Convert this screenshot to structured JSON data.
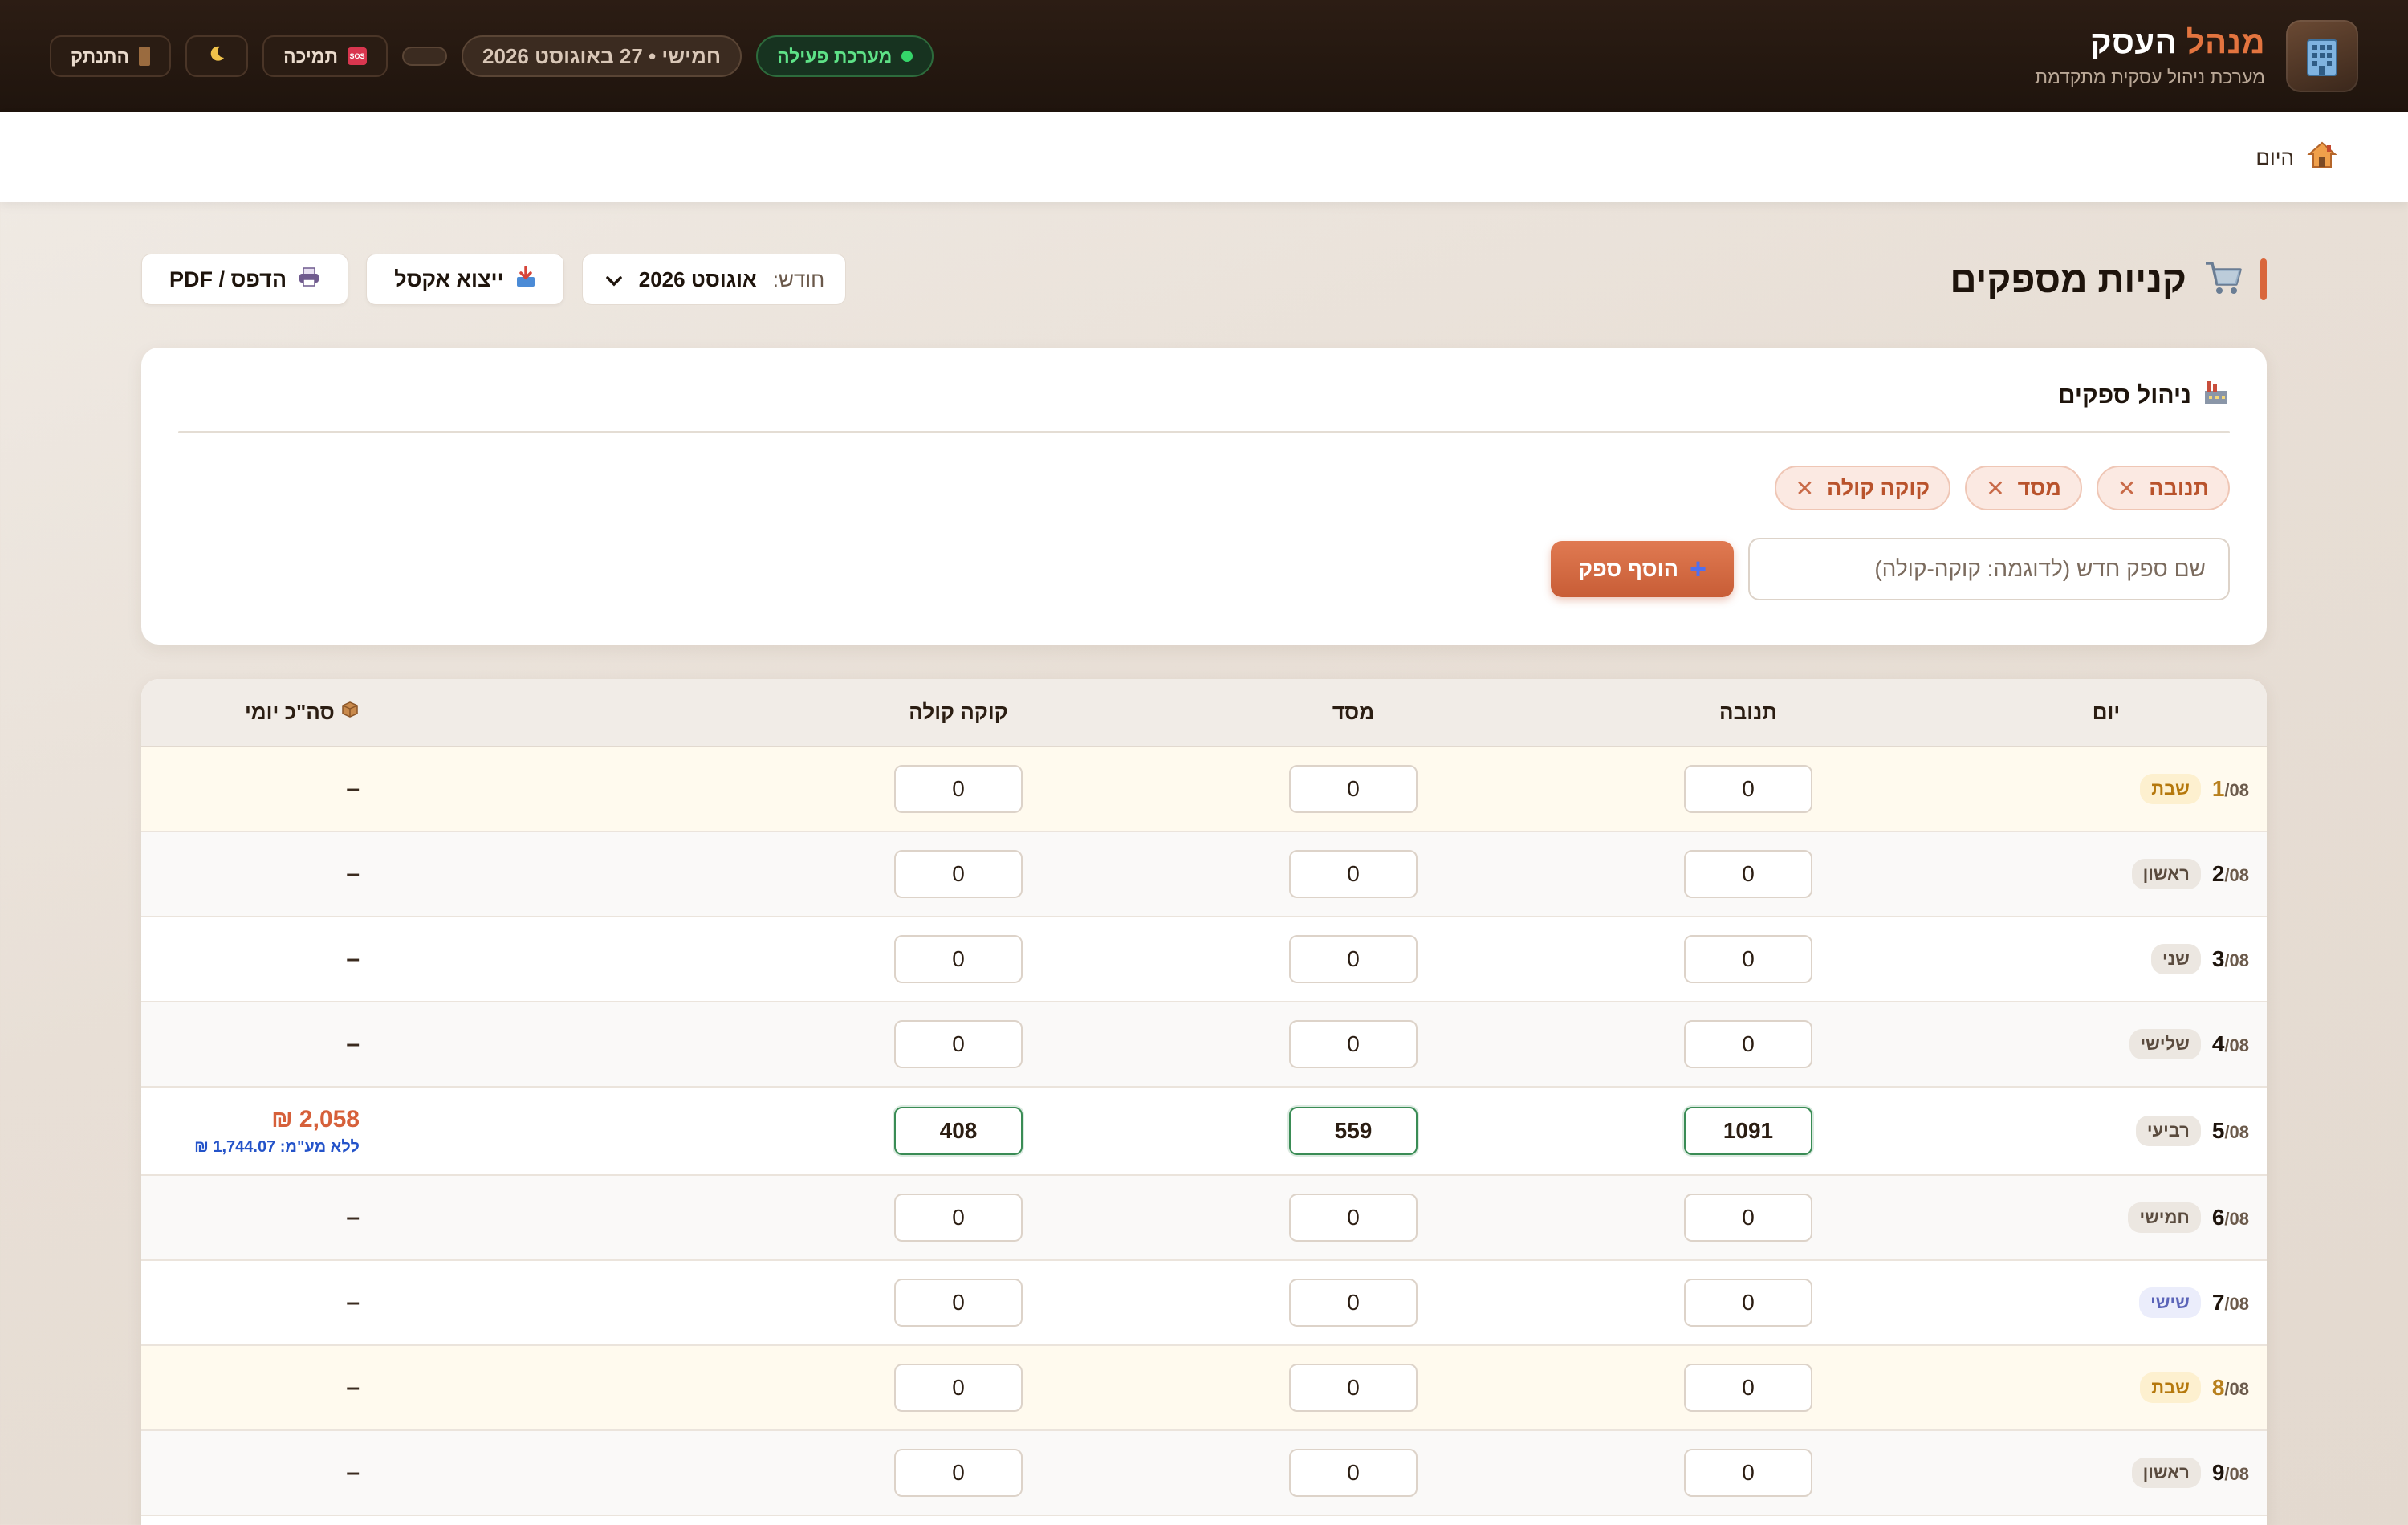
{
  "topbar": {
    "brand_title_accent": "מנהל",
    "brand_title_main": "העסק",
    "brand_subtitle": "מערכת ניהול עסקית מתקדמת",
    "status_label": "מערכת פעילה",
    "date_label": "חמישי • 27 באוגוסט 2026",
    "support_label": "תמיכה",
    "logout_label": "התנתק",
    "accent_color": "#e3743f",
    "status_color": "#35d56a"
  },
  "breadcrumb": {
    "home_label": "היום",
    "home_icon": "house-icon"
  },
  "page": {
    "title": "קניות מספקים",
    "title_icon": "cart-icon",
    "month_label": "חודש:",
    "month_value": "אוגוסט 2026",
    "export_excel_label": "ייצוא אקסל",
    "print_label": "הדפס / PDF"
  },
  "suppliers_card": {
    "title": "ניהול ספקים",
    "title_icon": "factory-icon",
    "chips": [
      {
        "label": "תנובה"
      },
      {
        "label": "מסד"
      },
      {
        "label": "קוקה קולה"
      }
    ],
    "new_supplier_placeholder": "שם ספק חדש (לדוגמה: קוקה-קולה)",
    "add_button_label": "הוסף ספק"
  },
  "table": {
    "headers": {
      "day": "יום",
      "col1": "תנובה",
      "col2": "מסד",
      "col3": "קוקה קולה",
      "total": "סה\"כ יומי",
      "total_icon": "box-icon"
    },
    "month_suffix": "/08",
    "rows": [
      {
        "day": "1",
        "suffix": "/08",
        "weekday": "שבת",
        "v1": "0",
        "v2": "0",
        "v3": "0",
        "total": "–",
        "net": ""
      },
      {
        "day": "2",
        "suffix": "/08",
        "weekday": "ראשון",
        "v1": "0",
        "v2": "0",
        "v3": "0",
        "total": "–",
        "net": ""
      },
      {
        "day": "3",
        "suffix": "/08",
        "weekday": "שני",
        "v1": "0",
        "v2": "0",
        "v3": "0",
        "total": "–",
        "net": ""
      },
      {
        "day": "4",
        "suffix": "/08",
        "weekday": "שלישי",
        "v1": "0",
        "v2": "0",
        "v3": "0",
        "total": "–",
        "net": ""
      },
      {
        "day": "5",
        "suffix": "/08",
        "weekday": "רביעי",
        "v1": "1091",
        "v2": "559",
        "v3": "408",
        "total": "2,058 ₪",
        "net": "ללא מע\"מ: 1,744.07 ₪"
      },
      {
        "day": "6",
        "suffix": "/08",
        "weekday": "חמישי",
        "v1": "0",
        "v2": "0",
        "v3": "0",
        "total": "–",
        "net": ""
      },
      {
        "day": "7",
        "suffix": "/08",
        "weekday": "שישי",
        "v1": "0",
        "v2": "0",
        "v3": "0",
        "total": "–",
        "net": ""
      },
      {
        "day": "8",
        "suffix": "/08",
        "weekday": "שבת",
        "v1": "0",
        "v2": "0",
        "v3": "0",
        "total": "–",
        "net": ""
      },
      {
        "day": "9",
        "suffix": "/08",
        "weekday": "ראשון",
        "v1": "0",
        "v2": "0",
        "v3": "0",
        "total": "–",
        "net": ""
      }
    ]
  }
}
